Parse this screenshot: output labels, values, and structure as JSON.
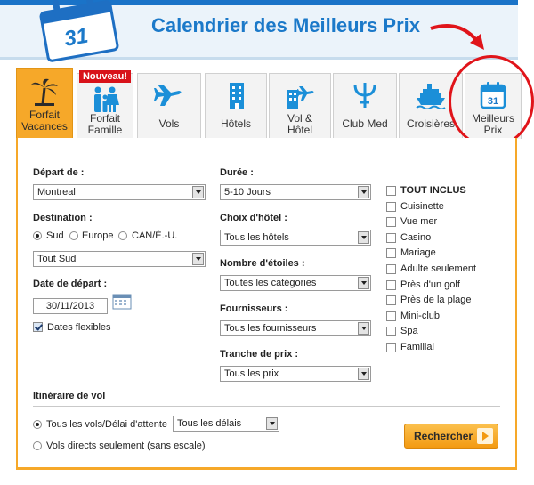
{
  "banner": {
    "title": "Calendrier des Meilleurs Prix",
    "calendar_number": "31"
  },
  "tabs": [
    {
      "label": "Forfait\nVacances",
      "icon": "palm-tree-icon",
      "active": true
    },
    {
      "label": "Forfait\nFamille",
      "icon": "family-icon",
      "badge": "Nouveau!"
    },
    {
      "label": "Vols",
      "icon": "airplane-icon"
    },
    {
      "label": "Hôtels",
      "icon": "hotel-building-icon"
    },
    {
      "label": "Vol &\nHôtel",
      "icon": "hotel-plane-icon"
    },
    {
      "label": "Club Med",
      "icon": "trident-icon"
    },
    {
      "label": "Croisières",
      "icon": "cruise-ship-icon"
    },
    {
      "label": "Meilleurs\nPrix",
      "icon": "calendar-icon",
      "calendar_number": "31"
    }
  ],
  "form": {
    "depart_label": "Départ de :",
    "depart_value": "Montreal",
    "destination_label": "Destination :",
    "dest_options": [
      "Sud",
      "Europe",
      "CAN/É.-U."
    ],
    "dest_selected": "Sud",
    "region_value": "Tout Sud",
    "date_label": "Date de départ :",
    "date_value": "30/11/2013",
    "flexible_label": "Dates flexibles",
    "duree_label": "Durée :",
    "duree_value": "5-10 Jours",
    "hotel_label": "Choix d'hôtel :",
    "hotel_value": "Tous les hôtels",
    "etoiles_label": "Nombre d'étoiles :",
    "etoiles_value": "Toutes les catégories",
    "fournisseurs_label": "Fournisseurs :",
    "fournisseurs_value": "Tous les fournisseurs",
    "prix_label": "Tranche de prix :",
    "prix_value": "Tous les prix",
    "amenities": [
      "TOUT INCLUS",
      "Cuisinette",
      "Vue mer",
      "Casino",
      "Mariage",
      "Adulte seulement",
      "Près d'un golf",
      "Près de la plage",
      "Mini-club",
      "Spa",
      "Familial"
    ],
    "itineraire_label": "Itinéraire de vol",
    "vols_all_label": "Tous les vols/Délai d'attente",
    "delai_value": "Tous les délais",
    "vols_direct_label": "Vols directs seulement (sans escale)",
    "search_label": "Rechercher"
  },
  "colors": {
    "accent": "#f6a829",
    "brand_blue": "#1b79c9",
    "annotation_red": "#e0141a"
  }
}
